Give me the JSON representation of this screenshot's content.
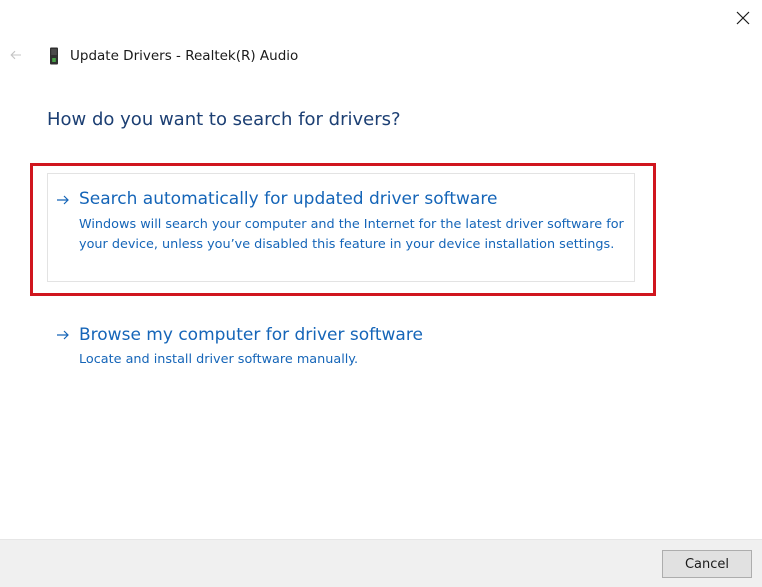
{
  "window": {
    "title": "Update Drivers - Realtek(R) Audio",
    "close_icon": "close-icon",
    "back_icon": "back-arrow-icon",
    "device_icon": "audio-device-icon"
  },
  "main": {
    "question": "How do you want to search for drivers?",
    "options": [
      {
        "icon": "arrow-right-icon",
        "title": "Search automatically for updated driver software",
        "description": "Windows will search your computer and the Internet for the latest driver software for your device, unless you’ve disabled this feature in your device installation settings.",
        "highlighted": true
      },
      {
        "icon": "arrow-right-icon",
        "title": "Browse my computer for driver software",
        "description": "Locate and install driver software manually.",
        "highlighted": false
      }
    ]
  },
  "footer": {
    "cancel_label": "Cancel"
  },
  "colors": {
    "link_blue": "#1565b8",
    "heading_blue": "#1c3f73",
    "highlight_red": "#d0161e",
    "footer_bg": "#f0f0f0"
  }
}
